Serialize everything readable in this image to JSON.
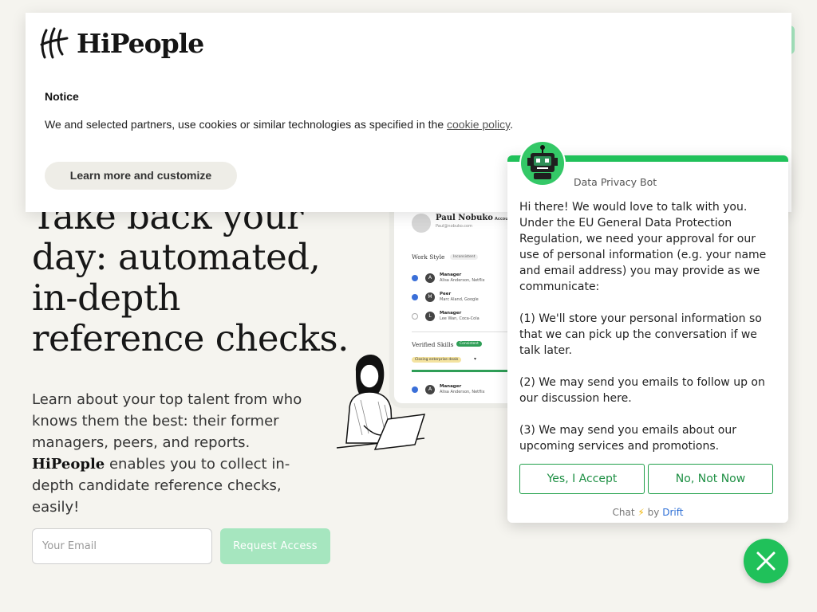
{
  "hero": {
    "title_lines": [
      "Take back your",
      "day: automated,",
      "in-depth",
      "reference checks."
    ],
    "sub_before": "Learn about your top talent from who knows them the best: their former managers, peers, and reports.",
    "sub_brand": "HiPeople",
    "sub_after": "enables you to collect in-depth candidate reference checks, easily!",
    "email_placeholder": "Your Email",
    "request_label": "Request Access"
  },
  "product_card": {
    "name": "Paul Nobuko",
    "email": "Paul@nobuko.com",
    "account_label": "Accou",
    "work_style": "Work Style",
    "work_tag": "Inconsistent",
    "rows": [
      {
        "letter": "A",
        "role": "Manager",
        "who": "Alisa Anderson, Netflix",
        "checked": true
      },
      {
        "letter": "M",
        "role": "Peer",
        "who": "Marc Aland, Google",
        "checked": true
      },
      {
        "letter": "L",
        "role": "Manager",
        "who": "Lee Wan, Coca-Cola",
        "checked": false
      }
    ],
    "skills": "Verified Skills",
    "skills_tag": "Consistent",
    "skill_item": "Closing enterprise deals",
    "last_row": {
      "letter": "A",
      "role": "Manager",
      "who": "Alisa Anderson, Netflix"
    }
  },
  "cookie": {
    "brand": "HiPeople",
    "title": "Notice",
    "text_before": "We and selected partners, use cookies or similar technologies as specified in the",
    "link": "cookie policy",
    "text_after": ".",
    "learn_label": "Learn more and customize"
  },
  "chat": {
    "bot_name": "Data Privacy Bot",
    "message": "Hi there! We would love to talk with you. Under the EU General Data Protection Regulation, we need your approval for our use of personal information (e.g. your name and email address) you may provide as we communicate:\n\n(1) We'll store your personal information so that we can pick up the conversation if we talk later.\n\n(2) We may send you emails to follow up on our discussion here.\n\n(3) We may send you emails about our upcoming services and promotions.\n\nIs this okay with you?",
    "accept_label": "Yes, I Accept",
    "decline_label": "No, Not Now",
    "footer_chat": "Chat",
    "footer_by": "by",
    "footer_brand": "Drift"
  },
  "colors": {
    "accent_green": "#20c15a",
    "request_button": "#a6e6bf",
    "background": "#f5f4ef"
  },
  "icons": [
    "hipeople-logo-icon",
    "bot-icon",
    "bolt-icon",
    "close-icon",
    "woman-laptop-illustration"
  ]
}
